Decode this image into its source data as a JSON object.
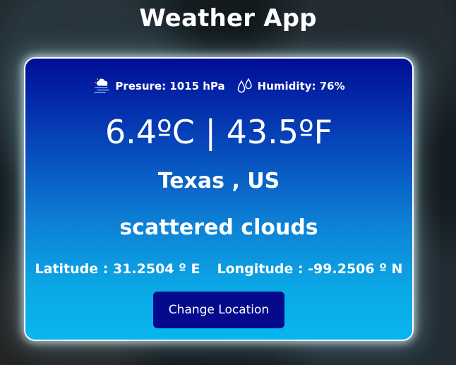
{
  "app": {
    "title": "Weather App"
  },
  "card": {
    "pressure_label": "Presure: 1015 hPa",
    "humidity_label": "Humidity: 76%",
    "temperature": "6.4ºC | 43.5ºF",
    "location": "Texas , US",
    "description": "scattered clouds",
    "latitude": "Latitude : 31.2504 º E",
    "longitude": "Longitude : -99.2506 º N",
    "change_location_label": "Change Location"
  },
  "icons": {
    "pressure": "pressure-wind-icon",
    "humidity": "humidity-drops-icon"
  },
  "colors": {
    "accent": "#050a8d",
    "card_top": "#000d96",
    "card_bottom": "#08b6ee",
    "text": "#ffffff"
  }
}
